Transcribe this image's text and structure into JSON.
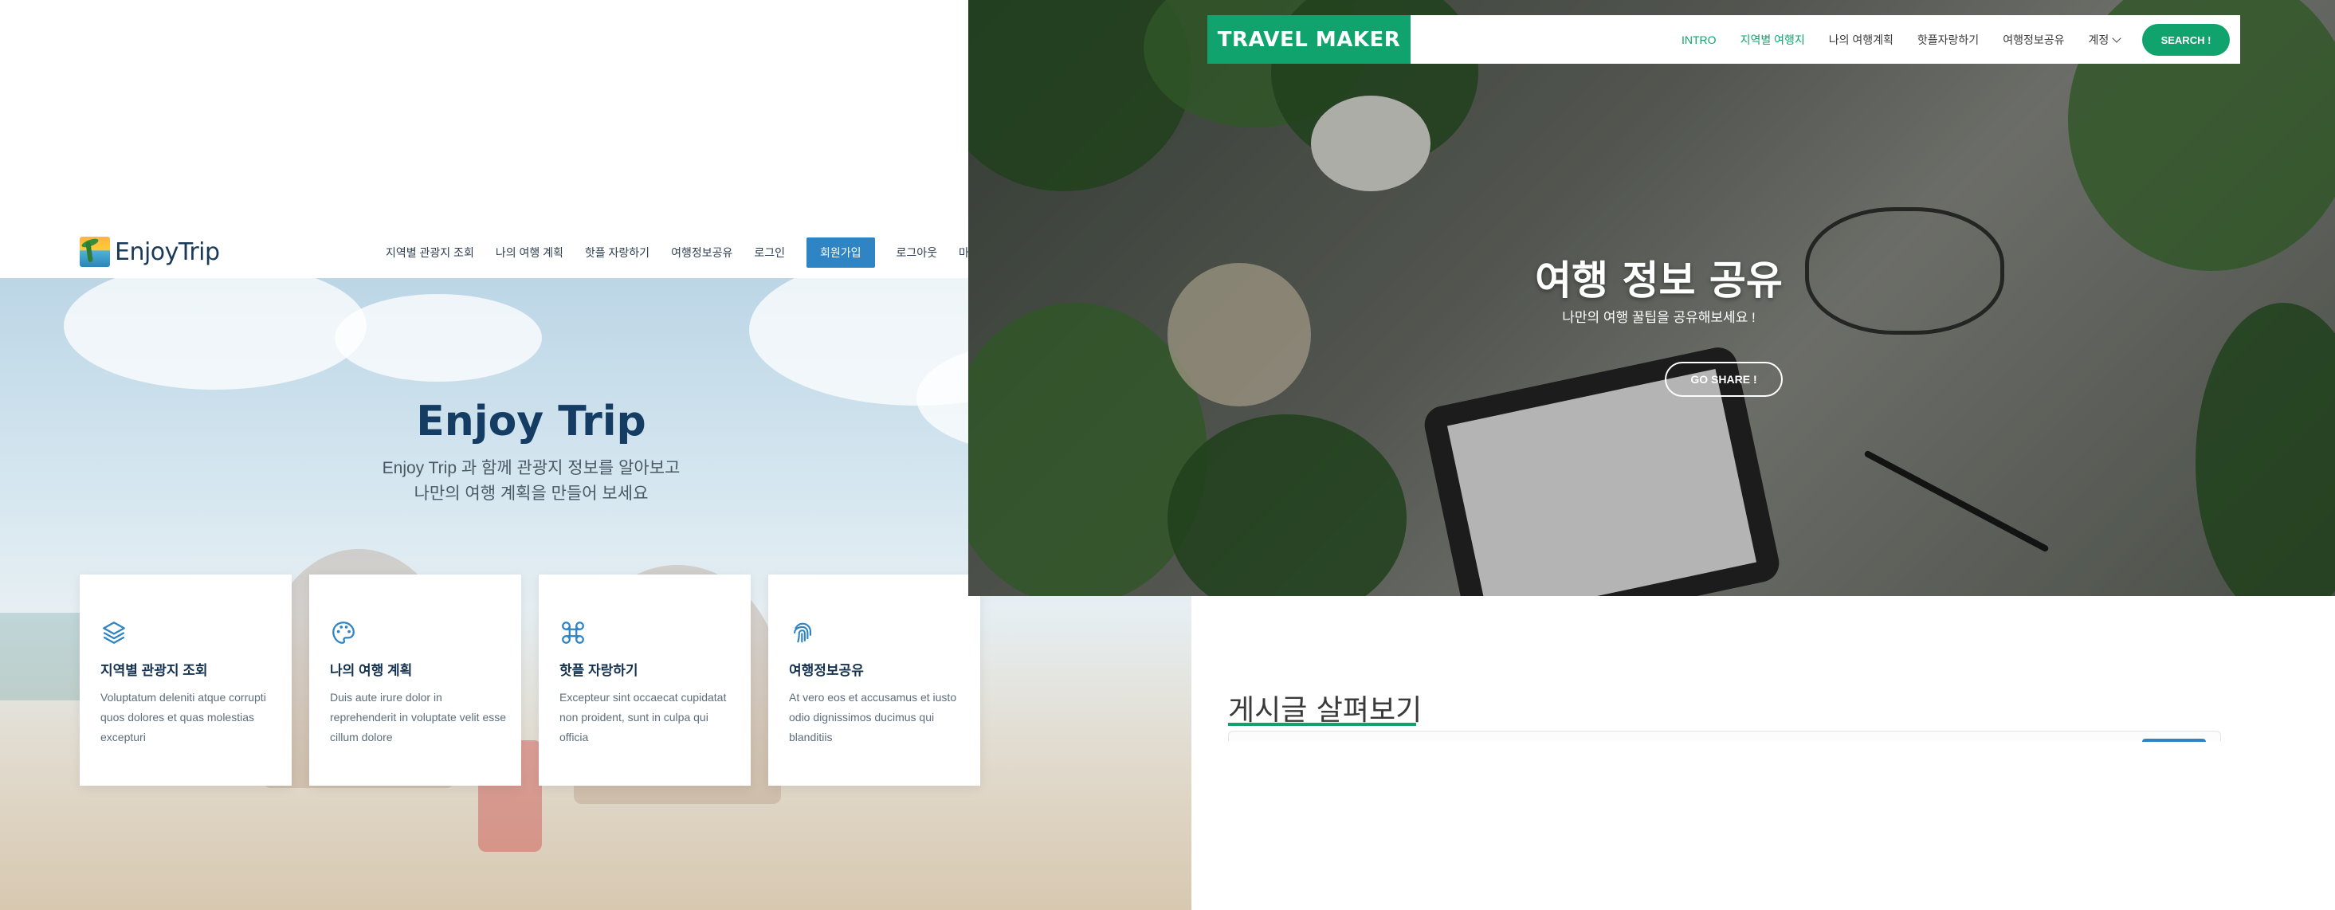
{
  "enjoytrip": {
    "logo_text": "EnjoyTrip",
    "nav": [
      "지역별 관광지 조회",
      "나의 여행 계획",
      "핫플 자랑하기",
      "여행정보공유",
      "로그인"
    ],
    "join_label": "회원가입",
    "nav_after": [
      "로그아웃",
      "마이페이지"
    ],
    "hero": {
      "title": "Enjoy Trip",
      "subtitle_line1": "Enjoy Trip 과 함께 관광지 정보를 알아보고",
      "subtitle_line2": "나만의 여행 계획을 만들어 보세요"
    },
    "cards": [
      {
        "icon": "layers-icon",
        "title": "지역별 관광지 조회",
        "desc": "Voluptatum deleniti atque corrupti quos dolores et quas molestias excepturi"
      },
      {
        "icon": "palette-icon",
        "title": "나의 여행 계획",
        "desc": "Duis aute irure dolor in reprehenderit in voluptate velit esse cillum dolore"
      },
      {
        "icon": "command-icon",
        "title": "핫플 자랑하기",
        "desc": "Excepteur sint occaecat cupidatat non proident, sunt in culpa qui officia"
      },
      {
        "icon": "fingerprint-icon",
        "title": "여행정보공유",
        "desc": "At vero eos et accusamus et iusto odio dignissimos ducimus qui blanditiis"
      }
    ],
    "colors": {
      "accent": "#2f84c4",
      "title": "#153d63"
    }
  },
  "travelmaker": {
    "logo_text": "TRAVEL MAKER",
    "nav": [
      "INTRO",
      "지역별 여행지",
      "나의 여행계획",
      "핫플자랑하기",
      "여행정보공유",
      "계정"
    ],
    "search_label": "SEARCH !",
    "hero": {
      "title": "여행 정보 공유",
      "subtitle": "나만의 여행 꿀팁을 공유해보세요 !",
      "button": "GO SHARE !"
    },
    "section_title": "게시글 살펴보기",
    "colors": {
      "accent": "#11a36d"
    }
  }
}
